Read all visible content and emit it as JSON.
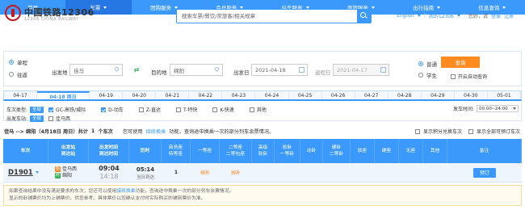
{
  "header": {
    "logo_cn": "中国铁路12306",
    "logo_en": "12306 CHINA RAILWAY",
    "search_placeholder": "搜索车票/餐饮/常旅客/相关规章",
    "lang": "English",
    "my": "我的12306",
    "greeting": "您好，请",
    "login": "登录",
    "register": "注册"
  },
  "nav": [
    {
      "label": "首页",
      "has_caret": false,
      "active": false
    },
    {
      "label": "车票",
      "has_caret": true,
      "active": true
    },
    {
      "label": "团购服务",
      "has_caret": true,
      "active": false
    },
    {
      "label": "会员服务",
      "has_caret": true,
      "active": false
    },
    {
      "label": "站车服务",
      "has_caret": true,
      "active": false
    },
    {
      "label": "商旅服务",
      "has_caret": true,
      "active": false
    },
    {
      "label": "出行指南",
      "has_caret": true,
      "active": false
    },
    {
      "label": "信息查询",
      "has_caret": true,
      "active": false
    }
  ],
  "query": {
    "trip_oneway": "单程",
    "trip_round": "往返",
    "from_label": "出发地",
    "from_value": "佳马",
    "to_label": "目的地",
    "to_value": "绵阳",
    "depart_label": "出发日",
    "depart_value": "2021-04-18",
    "return_label": "返程日",
    "return_value": "2021-04-17",
    "normal": "普通",
    "student": "学生",
    "query_btn": "查询",
    "auto_query": "开启自动查询"
  },
  "date_tabs": [
    "04-17",
    "04-18 周日",
    "04-19",
    "04-20",
    "04-21",
    "04-22",
    "04-23",
    "04-24",
    "04-25",
    "04-26",
    "04-27",
    "04-28",
    "04-29",
    "04-30",
    "05-01"
  ],
  "filters": {
    "train_type_label": "车次类型:",
    "all": "全部",
    "types": [
      {
        "label": "GC-高铁/城际",
        "checked": true
      },
      {
        "label": "D-动车",
        "checked": true
      },
      {
        "label": "Z-直达",
        "checked": false
      },
      {
        "label": "T-特快",
        "checked": false
      },
      {
        "label": "K-快速",
        "checked": false
      },
      {
        "label": "其他",
        "checked": false
      }
    ],
    "depart_station_label": "出发车站:",
    "station": "佳马西",
    "depart_time_label": "发车时间:",
    "depart_time_value": "00:00--24:00"
  },
  "result": {
    "route": "佳马 --> 绵阳（4月18日 周日）共计",
    "count": "1",
    "count_suffix": "个车次",
    "tip_pre": "您可使用",
    "tip_link": "接续换乘",
    "tip_post": "功能，查询途中换乘一次的部分列车余票情况。",
    "opt_points": "显示积分兑换车次",
    "opt_all": "显示全部可预订车次"
  },
  "table": {
    "headers": [
      "车次",
      "出发站\n到达站",
      "出发时间\n到达时间",
      "历时",
      "商务座\n特等座",
      "一等座",
      "二等座\n二等包座",
      "高级\n软卧",
      "软卧\n一等卧",
      "动卧",
      "硬卧\n二等卧",
      "软座",
      "硬座",
      "无座",
      "其他",
      "备注"
    ],
    "row": {
      "train": "D1901",
      "from": "佳马西",
      "to": "绵阳",
      "from_badge": "始",
      "to_badge": "终",
      "dep_time": "09:04",
      "arr_time": "14:18",
      "duration": "05:14",
      "duration_note": "当日到达",
      "business": "1",
      "first": "候补",
      "second": "候补",
      "book": "预订"
    }
  },
  "notes": {
    "line1_pre": "如果查询结果中没有满足要求的车次，您还可以使用",
    "line1_link": "接续换乘",
    "line1_post": "功能，查询途中换乘一次的部分列车余票情况。",
    "line2": "显示的卧铺票价均为上铺票价，供您参考。具体票价以您确认支付时实际购买的铺别票价为准。"
  }
}
